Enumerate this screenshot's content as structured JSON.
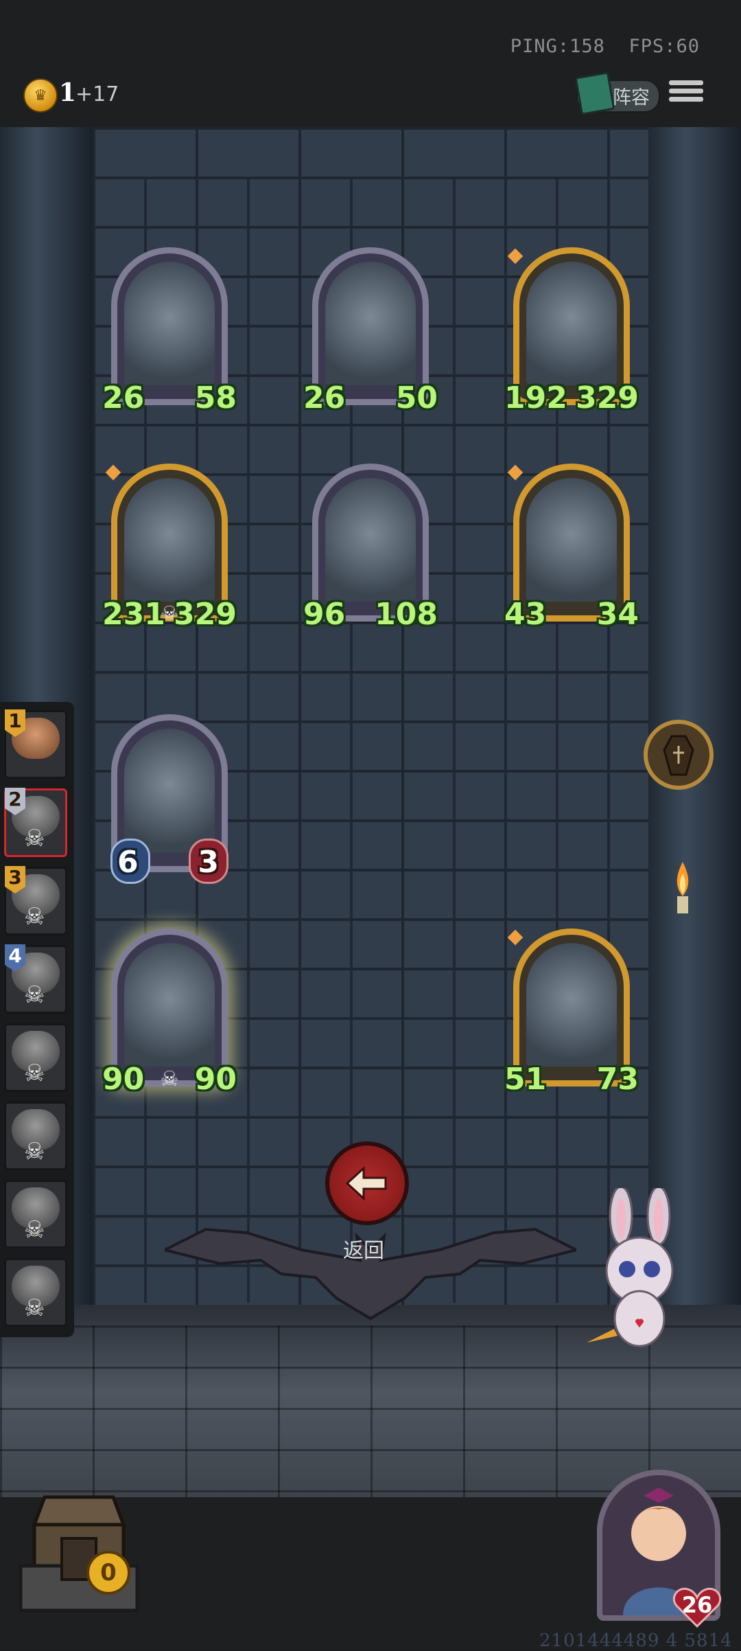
{
  "status": {
    "ping": "PING:158",
    "fps": "FPS:60"
  },
  "currency": {
    "coins": "1",
    "income": "+17",
    "icon": "crown-coin-icon"
  },
  "header": {
    "lineup_label": "阵容",
    "menu_icon": "hamburger-menu-icon"
  },
  "board": {
    "units": [
      {
        "name": "knight-bow",
        "attack": "26",
        "health": "58",
        "frame": "silver"
      },
      {
        "name": "red-hair-lady-1",
        "attack": "26",
        "health": "50",
        "frame": "silver"
      },
      {
        "name": "red-hair-lady-2",
        "attack": "192",
        "health": "329",
        "frame": "gold"
      },
      {
        "name": "yellow-robot",
        "attack": "231",
        "health": "329",
        "frame": "gold"
      },
      {
        "name": "old-card-player",
        "attack": "96",
        "health": "108",
        "frame": "silver"
      },
      {
        "name": "leaf-robot",
        "attack": "43",
        "health": "34",
        "frame": "gold"
      },
      {
        "name": "bird-musician",
        "attack": "6",
        "health": "3",
        "frame": "silver"
      },
      {
        "name": "eyepatch-butcher",
        "attack": "90",
        "health": "90",
        "frame": "silver"
      },
      {
        "name": "clock-clown",
        "attack": "51",
        "health": "73",
        "frame": "gold"
      }
    ]
  },
  "roster": {
    "slots": [
      {
        "rank": "1",
        "name": "girl-player"
      },
      {
        "rank": "2",
        "name": "dark-hair-player"
      },
      {
        "rank": "3",
        "name": "grey-hat-player"
      },
      {
        "rank": "4",
        "name": "helmet-player"
      },
      {
        "rank": "",
        "name": "pale-player"
      },
      {
        "rank": "",
        "name": "bear-player"
      },
      {
        "rank": "",
        "name": "wolf-player"
      },
      {
        "rank": "",
        "name": "shadow-player"
      }
    ]
  },
  "controls": {
    "back_label": "返回"
  },
  "chest": {
    "count": "0"
  },
  "hero": {
    "health": "26"
  },
  "footer": {
    "seed": "2101444489 4 5814"
  },
  "colors": {
    "stat_green": "#b8f57a",
    "gold_frame": "#d29a2e",
    "silver_frame": "#7f7d96",
    "back_red": "#b22a2a"
  }
}
